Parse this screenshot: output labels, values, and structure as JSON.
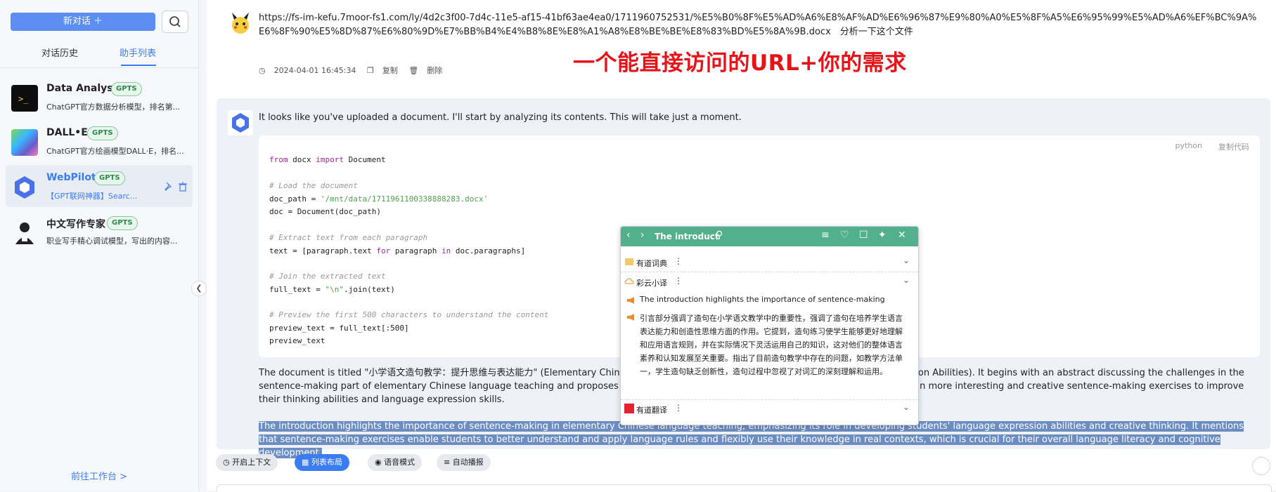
{
  "sidebar": {
    "new_chat": "新对话 ＋",
    "tabs": [
      "对话历史",
      "助手列表"
    ],
    "assistants": [
      {
        "name": "Data Analyst",
        "badge": "GPTS",
        "desc": "ChatGPT官方数据分析模型，排名第..."
      },
      {
        "name": "DALL•E",
        "badge": "GPTS",
        "desc": "ChatGPT官方绘画模型DALL·E，排名..."
      },
      {
        "name": "WebPilot",
        "badge": "GPTS",
        "desc": "【GPT联网神器】Searc..."
      },
      {
        "name": "中文写作专家",
        "badge": "GPTS",
        "desc": "职业写手精心调试模型，写出的内容..."
      }
    ],
    "workbench": "前往工作台 >"
  },
  "user_message": {
    "text": "https://fs-im-kefu.7moor-fs1.com/ly/4d2c3f00-7d4c-11e5-af15-41bf63ae4ea0/1711960752531/%E5%B0%8F%E5%AD%A6%E8%AF%AD%E6%96%87%E9%80%A0%E5%8F%A5%E6%95%99%E5%AD%A6%EF%BC%9A%E6%8F%90%E5%8D%87%E6%80%9D%E7%BB%B4%E4%B8%8E%E8%A1%A8%E8%BE%BE%E8%83%BD%E5%8A%9B.docx　分析一下这个文件",
    "time": "2024-04-01 16:45:34",
    "copy": "复制",
    "delete": "删除"
  },
  "annotation": "一个能直接访问的URL+你的需求",
  "assistant_message": {
    "intro": "It looks like you've uploaded a document. I'll start by analyzing its contents. This will take just a moment.",
    "code_lang": "python",
    "code_copy": "复制代码",
    "code": {
      "l1_kw1": "from",
      "l1_mod": " docx ",
      "l1_kw2": "import",
      "l1_rest": " Document",
      "l3": "# Load the document",
      "l4_a": "doc_path = ",
      "l4_s": "'/mnt/data/1711961100338888283.docx'",
      "l5": "doc = Document(doc_path)",
      "l7": "# Extract text from each paragraph",
      "l8_a": "text = [paragraph.text ",
      "l8_k1": "for",
      "l8_b": " paragraph ",
      "l8_k2": "in",
      "l8_c": " doc.paragraphs]",
      "l10": "# Join the extracted text",
      "l11_a": "full_text = ",
      "l11_s": "\"\\n\"",
      "l11_b": ".join(text)",
      "l13": "# Preview the first 500 characters to understand the content",
      "l14": "preview_text = full_text[:500]",
      "l15": "preview_text"
    },
    "para1": "The document is titled \"小学语文造句教学：提升思维与表达能力\" (Elementary Chinese Sentence-Making Teaching: Enhancing Thinking and Expression Abilities). It begins with an abstract discussing the challenges in the sentence-making part of elementary Chinese language teaching and proposes innovative teaching strategies. It suggests teachers should design more interesting and creative sentence-making exercises to improve their thinking abilities and language expression skills.",
    "para2": "The introduction highlights the importance of sentence-making in elementary Chinese language teaching, emphasizing its role in developing students' language expression abilities and creative thinking. It mentions that sentence-making exercises enable students to better understand and apply language rules and flexibly use their knowledge in real contexts, which is crucial for their overall language literacy and cognitive development."
  },
  "bottom_bar": {
    "context": "开启上下文",
    "layout": "列表布局",
    "voice": "语音模式",
    "autoplay": "自动播报"
  },
  "popup": {
    "title": "The introduct",
    "sections": [
      "有道词典",
      "彩云小译",
      "有道翻译"
    ],
    "source": "The introduction highlights the importance of sentence-making",
    "translation": "引言部分强调了造句在小学语文教学中的重要性，强调了造句在培养学生语言表达能力和创造性思维方面的作用。它提到，造句练习使学生能够更好地理解和应用语言规则，并在实际情况下灵活运用自己的知识，这对他们的整体语言素养和认知发展至关重要。指出了目前造句教学中存在的问题，如教学方法单一，学生造句缺乏创新性，造句过程中忽视了对词汇的深刻理解和运用。"
  }
}
